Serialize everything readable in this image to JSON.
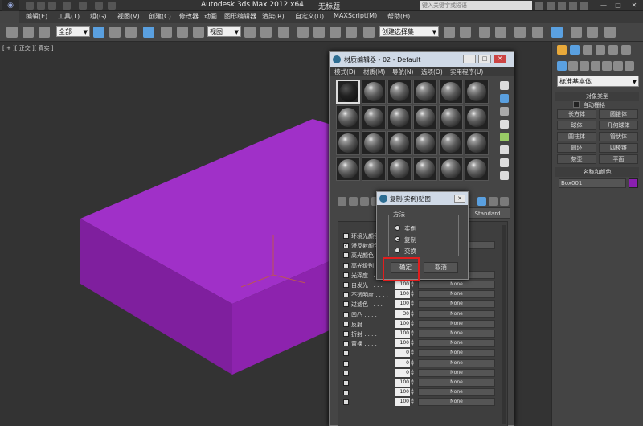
{
  "app": {
    "title": "Autodesk 3ds Max  2012 x64",
    "document": "无标题",
    "search_placeholder": "键入关键字或短语"
  },
  "menu": [
    "编辑(E)",
    "工具(T)",
    "组(G)",
    "视图(V)",
    "创建(C)",
    "修改器",
    "动画",
    "图形编辑器",
    "渲染(R)",
    "自定义(U)",
    "MAXScript(M)",
    "帮助(H)"
  ],
  "toolbar": {
    "filter": "全部",
    "coord": "视图",
    "selection_set": "创建选择集"
  },
  "viewport": {
    "label": "[ + ][ 正交 ][ 真实 ]",
    "object_color": "#9a2fbd"
  },
  "command_panel": {
    "category": "标准基本体",
    "object_type_title": "对象类型",
    "autogrid": "自动栅格",
    "buttons": [
      "长方体",
      "圆锥体",
      "球体",
      "几何球体",
      "圆柱体",
      "管状体",
      "圆环",
      "四棱锥",
      "茶壶",
      "平面"
    ],
    "name_color_title": "名称和颜色",
    "object_name": "Box001",
    "object_color": "#8a1fb0"
  },
  "material_editor": {
    "title": "材质编辑器 - 02 - Default",
    "menu": [
      "模式(D)",
      "材质(M)",
      "导航(N)",
      "选项(O)",
      "实用程序(U)"
    ],
    "standard_label": "Standard",
    "params": [
      {
        "label": "环境光颜色",
        "checked": false
      },
      {
        "label": "漫反射颜色",
        "checked": true,
        "map": "(.jpg)"
      },
      {
        "label": "高光颜色",
        "checked": false
      },
      {
        "label": "高光级别",
        "checked": false
      },
      {
        "label": "光泽度",
        "checked": false,
        "value": "100",
        "map": "None"
      },
      {
        "label": "自发光",
        "checked": false,
        "value": "100",
        "map": "None"
      },
      {
        "label": "不透明度",
        "checked": false,
        "value": "100",
        "map": "None"
      },
      {
        "label": "过滤色",
        "checked": false,
        "value": "100",
        "map": "None"
      },
      {
        "label": "凹凸",
        "checked": false,
        "value": "30",
        "map": "None"
      },
      {
        "label": "反射",
        "checked": false,
        "value": "100",
        "map": "None"
      },
      {
        "label": "折射",
        "checked": false,
        "value": "100",
        "map": "None"
      },
      {
        "label": "置换",
        "checked": false,
        "value": "100",
        "map": "None"
      },
      {
        "label": "",
        "checked": false,
        "value": "0",
        "map": "None"
      },
      {
        "label": "",
        "checked": false,
        "value": "0",
        "map": "None"
      },
      {
        "label": "",
        "checked": false,
        "value": "0",
        "map": "None"
      },
      {
        "label": "",
        "checked": false,
        "value": "100",
        "map": "None"
      },
      {
        "label": "",
        "checked": false,
        "value": "100",
        "map": "None"
      },
      {
        "label": "",
        "checked": false,
        "value": "100",
        "map": "None"
      }
    ]
  },
  "copy_dialog": {
    "title": "复制(实例)贴图",
    "method_label": "方法",
    "options": [
      {
        "label": "实例",
        "selected": false
      },
      {
        "label": "复制",
        "selected": true
      },
      {
        "label": "交换",
        "selected": false
      }
    ],
    "ok": "确定",
    "cancel": "取消"
  }
}
